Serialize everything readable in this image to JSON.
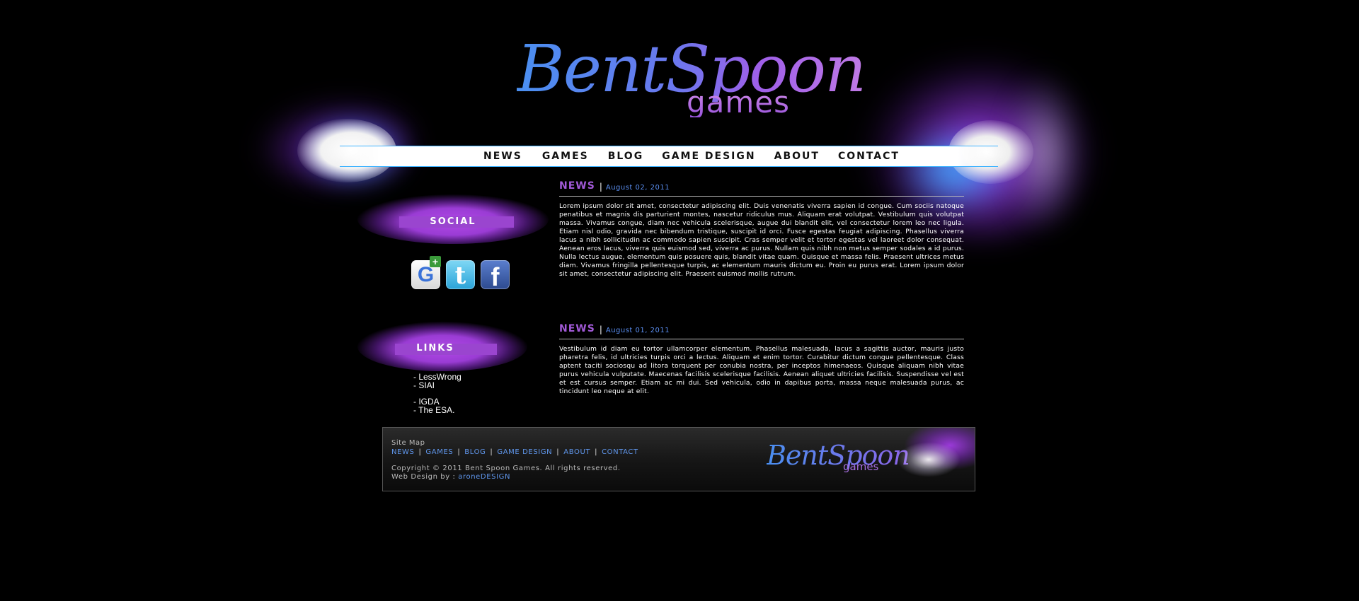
{
  "header": {
    "logo_main": "BentSpoon",
    "logo_sub": "games"
  },
  "nav": {
    "items": [
      {
        "label": "NEWS"
      },
      {
        "label": "GAMES"
      },
      {
        "label": "BLOG"
      },
      {
        "label": "GAME DESIGN"
      },
      {
        "label": "ABOUT"
      },
      {
        "label": "CONTACT"
      }
    ]
  },
  "sidebar": {
    "social_title": "SOCIAL",
    "social_icons": [
      "google-plus-icon",
      "twitter-icon",
      "facebook-icon"
    ],
    "links_title": "LINKS",
    "links_group1": [
      "- LessWrong",
      "- SIAI"
    ],
    "links_group2": [
      "- IGDA",
      "- The ESA."
    ]
  },
  "posts": [
    {
      "title": "NEWS",
      "separator": "|",
      "date": "August 02, 2011",
      "body": "Lorem ipsum dolor sit amet, consectetur adipiscing elit. Duis venenatis viverra sapien id congue. Cum sociis natoque penatibus et magnis dis parturient montes, nascetur ridiculus mus. Aliquam erat volutpat. Vestibulum quis volutpat massa. Vivamus congue, diam nec vehicula scelerisque, augue dui blandit elit, vel consectetur lorem leo nec ligula. Etiam nisl odio, gravida nec bibendum tristique, suscipit id orci. Fusce egestas feugiat adipiscing. Phasellus viverra lacus a nibh sollicitudin ac commodo sapien suscipit. Cras semper velit et tortor egestas vel laoreet dolor consequat. Aenean eros lacus, viverra quis euismod sed, viverra ac purus. Nullam quis nibh non metus semper sodales a id purus. Nulla lectus augue, elementum quis posuere quis, blandit vitae quam. Quisque et massa felis. Praesent ultrices metus diam. Vivamus fringilla pellentesque turpis, ac elementum mauris dictum eu. Proin eu purus erat. Lorem ipsum dolor sit amet, consectetur adipiscing elit. Praesent euismod mollis rutrum."
    },
    {
      "title": "NEWS",
      "separator": "|",
      "date": "August 01, 2011",
      "body": "Vestibulum id diam eu tortor ullamcorper elementum. Phasellus malesuada, lacus a sagittis auctor, mauris justo pharetra felis, id ultricies turpis orci a lectus. Aliquam et enim tortor. Curabitur dictum congue pellentesque. Class aptent taciti sociosqu ad litora torquent per conubia nostra, per inceptos himenaeos. Quisque aliquam nibh vitae purus vehicula vulputate. Maecenas facilisis scelerisque facilisis. Aenean aliquet ultricies facilisis. Suspendisse vel est et est cursus semper. Etiam ac mi dui. Sed vehicula, odio in dapibus porta, massa neque malesuada purus, ac tincidunt leo neque at elit."
    }
  ],
  "footer": {
    "sitemap_label": "Site Map",
    "nav": [
      "NEWS",
      "GAMES",
      "BLOG",
      "GAME DESIGN",
      "ABOUT",
      "CONTACT"
    ],
    "nav_separator": "|",
    "copyright": "Copyright © 2011 Bent Spoon Games. All rights reserved.",
    "credit_prefix": "Web Design by : ",
    "credit_link": "aroneDESIGN",
    "logo_main": "BentSpoon",
    "logo_sub": "games"
  },
  "colors": {
    "background": "#000000",
    "accent_purple": "#a25ad8",
    "accent_blue": "#5a8ef0",
    "nav_bar": "#ffffff"
  }
}
